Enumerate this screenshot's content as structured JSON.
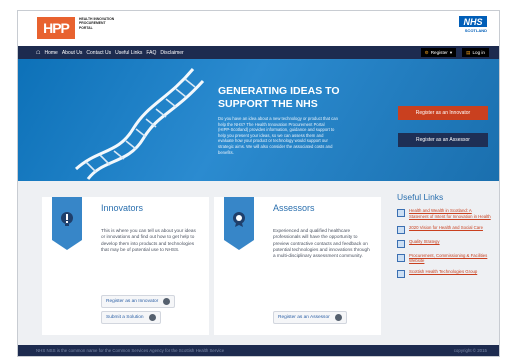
{
  "header": {
    "logo_text": "HPP",
    "logo_subtitle": "HEALTH INNOVATION PROCUREMENT PORTAL",
    "nhs_badge": "NHS",
    "nhs_sub": "SCOTLAND"
  },
  "nav": {
    "items": [
      "Home",
      "About Us",
      "Contact Us",
      "Useful Links",
      "FAQ",
      "Disclaimer"
    ],
    "register_label": "Register",
    "login_label": "Log in"
  },
  "hero": {
    "title": "GENERATING IDEAS TO SUPPORT THE NHS",
    "text": "Do you have an idea about a new technology or product that can help the NHS? The Health Innovation Procurement Portal (HIPP-Scotland) provides information, guidance and support to help you present your ideas, so we can assess them and evaluate how your product or technology would support our strategic aims. We will also consider the associated costs and benefits.",
    "register_innovator": "Register as an Innovator",
    "register_assessor": "Register as an Assessor"
  },
  "innovators": {
    "title": "Innovators",
    "text": "This is where you can tell us about your ideas or innovations and find out how to get help to develop them into products and technologies that may be of potential use to NHSS.",
    "register_button": "Register as an Innovator",
    "submit_button": "Submit a Solution"
  },
  "assessors": {
    "title": "Assessors",
    "text": "Experienced and qualified healthcare professionals will have the opportunity to preview contractive contacts and feedback on potential technologies and innovations through a multi-disciplinary assessment community.",
    "register_button": "Register as an Assessor"
  },
  "useful_links": {
    "title": "Useful Links",
    "items": [
      "Health and Wealth in Scotland: A Statement of Intent for Innovation in Health",
      "2020 Vision for Health and Social Care",
      "Quality Strategy",
      "Procurement, Commissioning & Facilities Website",
      "Scottish Health Technologies Group"
    ]
  },
  "footer": {
    "left": "NHS NSS is the common name for the Common Services Agency for the Scottish Health Service",
    "right": "copyright © 2015"
  },
  "colors": {
    "nav_bg": "#1d2b4f",
    "hero_blue": "#2b8bd0",
    "accent_red": "#c9401f",
    "logo_orange": "#e8622f",
    "nhs_blue": "#005eb8"
  }
}
